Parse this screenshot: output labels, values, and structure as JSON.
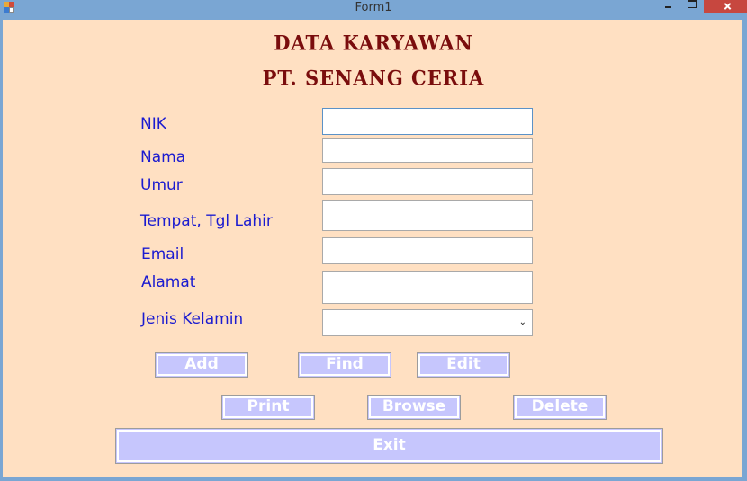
{
  "window": {
    "title": "Form1"
  },
  "header": {
    "line1": "DATA KARYAWAN",
    "line2": "PT. SENANG CERIA"
  },
  "form": {
    "nik_label": "NIK",
    "nama_label": "Nama",
    "umur_label": "Umur",
    "ttl_label": "Tempat, Tgl Lahir",
    "email_label": "Email",
    "alamat_label": "Alamat",
    "jk_label": "Jenis Kelamin",
    "nik_value": "",
    "nama_value": "",
    "umur_value": "",
    "ttl_value": "",
    "email_value": "",
    "alamat_value": "",
    "jk_value": ""
  },
  "buttons": {
    "add": "Add",
    "find": "Find",
    "edit": "Edit",
    "print": "Print",
    "browse": "Browse",
    "delete": "Delete",
    "exit": "Exit"
  },
  "icons": {
    "app": "form-app-icon",
    "minimize": "minimize-icon",
    "maximize": "maximize-icon",
    "close": "close-icon",
    "dropdown": "chevron-down-icon"
  },
  "colors": {
    "background": "#ffe0c2",
    "heading": "#7a0d0d",
    "label": "#1b1bd0",
    "button": "#c6c6fd",
    "titlebar": "#7aa6d3",
    "close": "#c7473f"
  }
}
